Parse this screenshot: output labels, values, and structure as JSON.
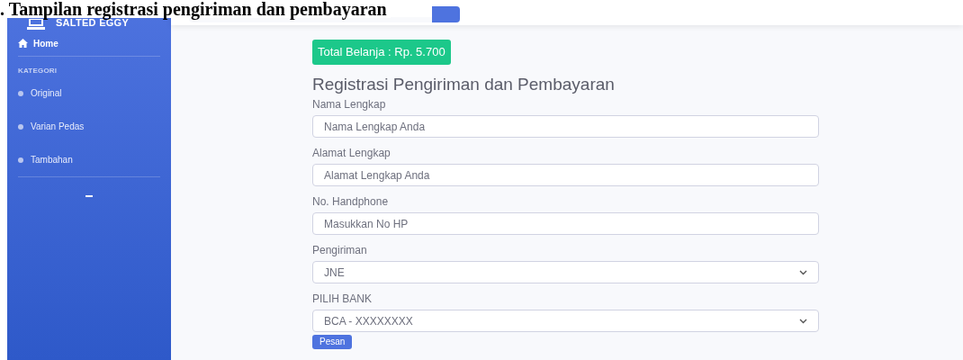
{
  "caption": ". Tampilan registrasi pengiriman dan pembayaran",
  "sidebar": {
    "brand": "SALTED EGGY",
    "home": {
      "label": "Home",
      "selected": true
    },
    "section": "KATEGORI",
    "items": [
      {
        "label": "Original"
      },
      {
        "label": "Varian Pedas"
      },
      {
        "label": "Tambahan"
      }
    ]
  },
  "total": "Total Belanja : Rp. 5.700",
  "heading": "Registrasi Pengiriman dan Pembayaran",
  "fields": [
    {
      "kind": "input",
      "label": "Nama Lengkap",
      "placeholder": "Nama Lengkap Anda"
    },
    {
      "kind": "input",
      "label": "Alamat Lengkap",
      "placeholder": "Alamat Lengkap Anda"
    },
    {
      "kind": "input",
      "label": "No. Handphone",
      "placeholder": "Masukkan No HP"
    },
    {
      "kind": "select",
      "label": "Pengiriman",
      "value": "JNE"
    },
    {
      "kind": "select",
      "label": "PILIH BANK",
      "value": "BCA - XXXXXXXX"
    }
  ],
  "submit": "Pesan"
}
